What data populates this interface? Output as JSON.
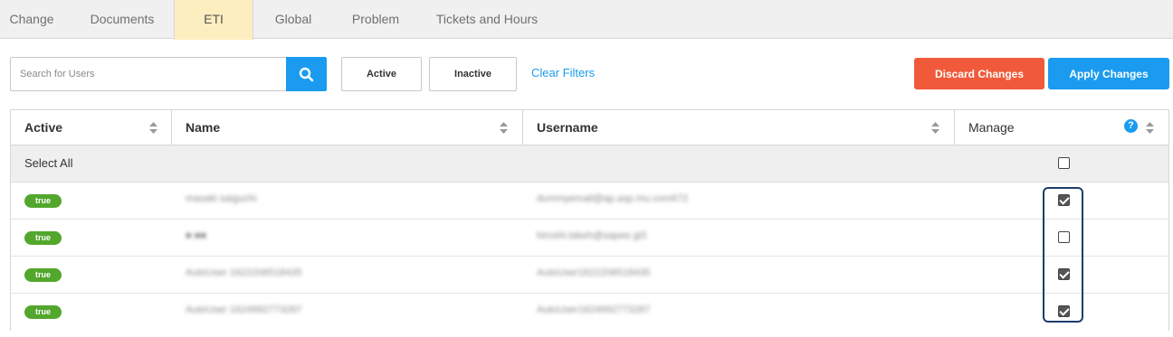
{
  "tabs": [
    {
      "label": "Change",
      "active": false
    },
    {
      "label": "Documents",
      "active": false
    },
    {
      "label": "ETI",
      "active": true
    },
    {
      "label": "Global",
      "active": false
    },
    {
      "label": "Problem",
      "active": false
    },
    {
      "label": "Tickets and Hours",
      "active": false
    }
  ],
  "toolbar": {
    "search_placeholder": "Search for Users",
    "search_icon": "search-icon",
    "active_label": "Active",
    "inactive_label": "Inactive",
    "clear_filters_label": "Clear Filters",
    "discard_label": "Discard Changes",
    "apply_label": "Apply Changes"
  },
  "colors": {
    "accent_blue": "#1a9bef",
    "discard_red": "#f05a3a",
    "active_tab_bg": "#fdeec0",
    "badge_green": "#52a72c"
  },
  "table": {
    "columns": [
      {
        "label": "Active"
      },
      {
        "label": "Name"
      },
      {
        "label": "Username"
      },
      {
        "label": "Manage"
      }
    ],
    "help_icon": "?",
    "select_all_label": "Select All",
    "select_all_checked": false,
    "rows": [
      {
        "active": "true",
        "name": "masaki saiguchi",
        "username": "dummyemail@ap.asp.mu.com672",
        "manage": true
      },
      {
        "active": "true",
        "name": "■ ■■",
        "username": "hiroshi.takeh@sapee.gl3",
        "manage": false
      },
      {
        "active": "true",
        "name": "AutoUser 1622206518435",
        "username": "AutoUser1622206518435",
        "manage": true
      },
      {
        "active": "true",
        "name": "AutoUser 1624992773287",
        "username": "AutoUser1624992773287",
        "manage": true
      }
    ]
  }
}
